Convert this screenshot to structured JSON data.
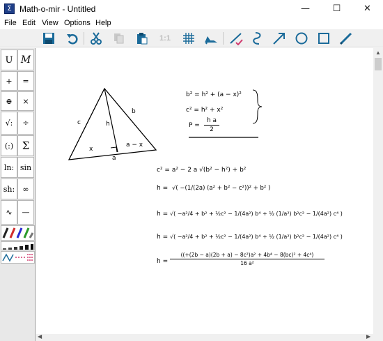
{
  "window": {
    "title": "Math-o-mir - Untitled",
    "app_icon_glyph": "Σ",
    "controls": {
      "minimize": "—",
      "maximize": "☐",
      "close": "✕"
    }
  },
  "menu": [
    "File",
    "Edit",
    "View",
    "Options",
    "Help"
  ],
  "toolbar": {
    "zoom_label": "1:1",
    "icons": [
      "save-icon",
      "undo-icon",
      "cut-icon",
      "copy-icon",
      "paste-icon",
      "zoom-icon",
      "grid-icon",
      "shoe-icon",
      "line-checkmark-icon",
      "curve-icon",
      "arrow-icon",
      "circle-icon",
      "rectangle-icon",
      "pen-icon"
    ]
  },
  "symbols": {
    "rows": [
      [
        "U",
        "M"
      ],
      [
        "+",
        "="
      ],
      [
        "⊕",
        "×"
      ],
      [
        "√:",
        "÷"
      ],
      [
        "(:)",
        "Σ"
      ],
      [
        "ln:",
        "sin"
      ],
      [
        "sh:",
        "∞"
      ],
      [
        "∿",
        "—"
      ]
    ]
  },
  "canvas": {
    "triangle_labels": {
      "c": "c",
      "h": "h",
      "b": "b",
      "x": "x",
      "a_minus_x": "a − x",
      "a": "a"
    },
    "system": {
      "eq1": "b² = h² + (a − x)²",
      "eq2": "c² = h² + x²",
      "eq3_lhs": "P =",
      "eq3_num": "h a",
      "eq3_den": "2"
    },
    "derivation": {
      "d1": "c² = a² − 2 a √(b² − h²) + b²",
      "d2_lhs": "h =",
      "d2_body": "√( −(1/(2a) (a² + b² − c²))² + b² )",
      "d3_lhs": "h =",
      "d3_body": "√( −a²/4 + b² + ½c² − 1/(4a²) b⁴ + ½ (1/a²) b²c² − 1/(4a²) c⁴ )",
      "d4_lhs": "h =",
      "d4_body": "√( −a²/4 + b² + ½c² − 1/(4a²) b⁴ + ½ (1/a²) b²c² − 1/(4a²) c⁴ )",
      "d5_lhs": "h =",
      "d5_num": "((+(2b − a)(2b + a) − 8c²)a² + 4b⁴ − 8(bc)² + 4c⁴)",
      "d5_den": "16 a²"
    }
  }
}
